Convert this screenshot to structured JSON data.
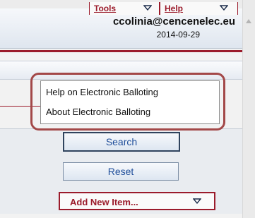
{
  "header": {
    "user_email": "ccolinia@cencenelec.eu",
    "date": "2014-09-29"
  },
  "menu": {
    "tools_label": "Tools",
    "help_label": "Help"
  },
  "help_dropdown": {
    "items": [
      {
        "label": "Help on Electronic Balloting"
      },
      {
        "label": "About Electronic Balloting"
      }
    ]
  },
  "actions": {
    "search_label": "Search",
    "reset_label": "Reset",
    "add_new_item_label": "Add New Item..."
  },
  "colors": {
    "accent_red": "#9b1b2b",
    "link_blue": "#1f4e9a",
    "highlight": "#a34848"
  },
  "icons": {
    "dropdown": "chevron-down-icon",
    "scroll_up": "scroll-up-arrow-icon"
  }
}
